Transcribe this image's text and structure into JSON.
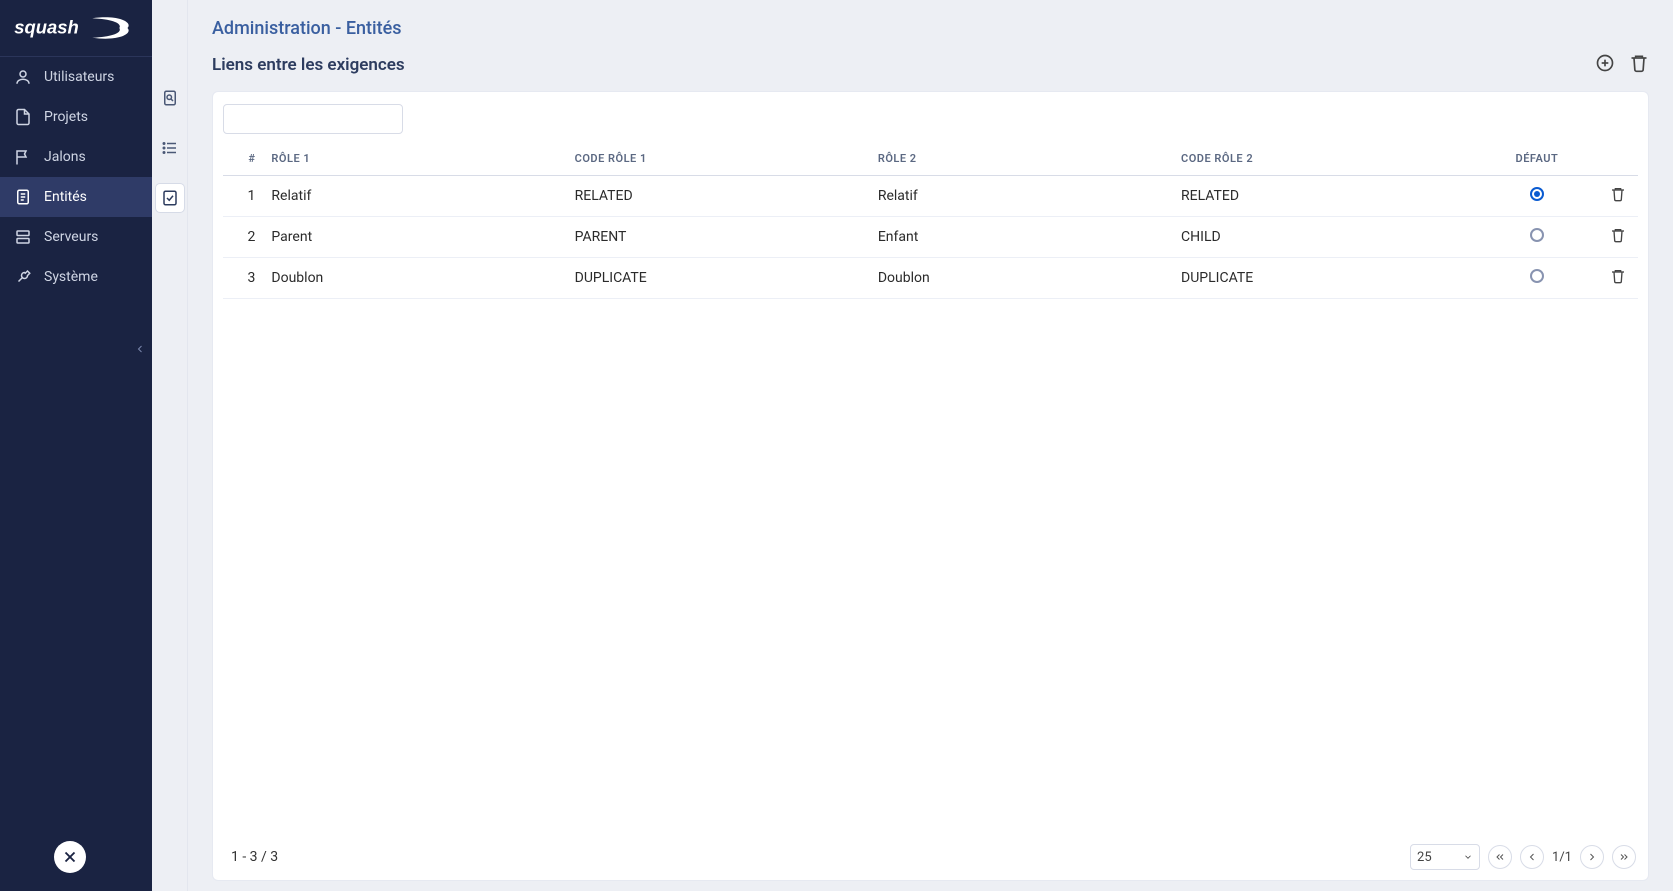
{
  "app_name": "squash",
  "nav": {
    "items": [
      {
        "name": "users",
        "label": "Utilisateurs"
      },
      {
        "name": "projects",
        "label": "Projets"
      },
      {
        "name": "milestones",
        "label": "Jalons"
      },
      {
        "name": "entities",
        "label": "Entités"
      },
      {
        "name": "servers",
        "label": "Serveurs"
      },
      {
        "name": "system",
        "label": "Système"
      }
    ],
    "active_index": 3
  },
  "subnav": {
    "items": [
      {
        "name": "subnav-search",
        "label": "search-doc-icon"
      },
      {
        "name": "subnav-list",
        "label": "list-icon"
      },
      {
        "name": "subnav-checklist",
        "label": "checklist-icon"
      }
    ],
    "active_index": 2
  },
  "header": {
    "breadcrumb": "Administration - Entités",
    "subtitle": "Liens entre les exigences"
  },
  "table": {
    "columns": {
      "idx": "#",
      "role1": "RÔLE 1",
      "code1": "CODE RÔLE 1",
      "role2": "RÔLE 2",
      "code2": "CODE RÔLE 2",
      "def": "DÉFAUT"
    },
    "rows": [
      {
        "idx": "1",
        "role1": "Relatif",
        "code1": "RELATED",
        "role2": "Relatif",
        "code2": "RELATED",
        "default": true
      },
      {
        "idx": "2",
        "role1": "Parent",
        "code1": "PARENT",
        "role2": "Enfant",
        "code2": "CHILD",
        "default": false
      },
      {
        "idx": "3",
        "role1": "Doublon",
        "code1": "DUPLICATE",
        "role2": "Doublon",
        "code2": "DUPLICATE",
        "default": false
      }
    ]
  },
  "footer": {
    "range_text": "1 - 3 / 3",
    "page_size": "25",
    "page_text": "1/1"
  },
  "search": {
    "placeholder": ""
  }
}
